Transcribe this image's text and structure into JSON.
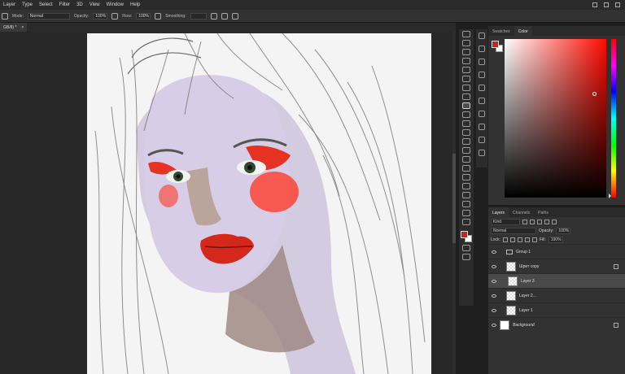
{
  "menubar": {
    "items": [
      "Layer",
      "Type",
      "Select",
      "Filter",
      "3D",
      "View",
      "Window",
      "Help"
    ]
  },
  "options": {
    "mode_label": "Mode:",
    "mode_value": "Normal",
    "opacity_label": "Opacity:",
    "opacity_value": "100%",
    "flow_label": "Flow:",
    "flow_value": "100%",
    "smoothing_label": "Smoothing:"
  },
  "document": {
    "tab_label": "GB/8) *",
    "close": "×"
  },
  "colors": {
    "foreground": "#c9221b",
    "background": "#ffffff"
  },
  "color_panel": {
    "tabs": [
      "Swatches",
      "Color"
    ],
    "active_tab": "Color"
  },
  "layers_panel": {
    "tabs": [
      "Layers",
      "Channels",
      "Paths"
    ],
    "filter_value": "Kind",
    "blend_mode": "Normal",
    "opacity_label": "Opacity:",
    "opacity_value": "100%",
    "lock_label": "Lock:",
    "fill_label": "Fill:",
    "fill_value": "100%",
    "layers": [
      {
        "name": "Group 1",
        "kind": "group",
        "selected": false
      },
      {
        "name": "Шрит copy",
        "kind": "layer",
        "selected": false
      },
      {
        "name": "Layer 3",
        "kind": "layer",
        "selected": true
      },
      {
        "name": "Layer 2...",
        "kind": "layer",
        "selected": false
      },
      {
        "name": "Layer 1",
        "kind": "layer",
        "selected": false
      },
      {
        "name": "Background",
        "kind": "background",
        "selected": false
      }
    ]
  }
}
